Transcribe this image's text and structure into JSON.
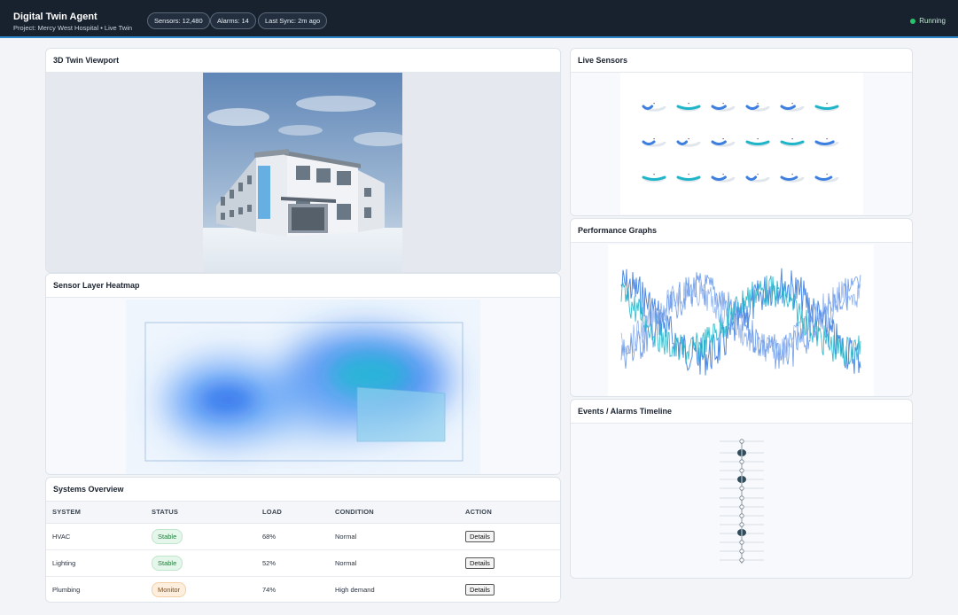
{
  "header": {
    "title": "Digital Twin Agent",
    "subtitle": "Project: Mercy West Hospital • Live Twin",
    "pills": {
      "sensors": "Sensors: 12,480",
      "alarms": "Alarms: 14",
      "sync": "Last Sync: 2m ago"
    },
    "status": "Running",
    "status_color": "#27c26a"
  },
  "panels": {
    "viewport": "3D Twin Viewport",
    "heatmap": "Sensor Layer Heatmap",
    "systems": "Systems Overview",
    "sensors": "Live Sensors",
    "performance": "Performance Graphs",
    "timeline": "Events / Alarms Timeline"
  },
  "table": {
    "headers": [
      "SYSTEM",
      "STATUS",
      "LOAD",
      "CONDITION",
      "ACTION"
    ],
    "rows": [
      {
        "system": "HVAC",
        "status": "Stable",
        "load": "68%",
        "condition": "Normal",
        "action": "Details"
      },
      {
        "system": "Lighting",
        "status": "Stable",
        "load": "52%",
        "condition": "Normal",
        "action": "Details"
      },
      {
        "system": "Plumbing",
        "status": "Monitor",
        "load": "74%",
        "condition": "High demand",
        "action": "Details"
      }
    ]
  },
  "colors": {
    "accent": "#2d86c8",
    "teal": "#1fb5c9",
    "blue": "#3d7fe0",
    "stable": "#1f7a3b",
    "monitor": "#8a4b0e"
  }
}
